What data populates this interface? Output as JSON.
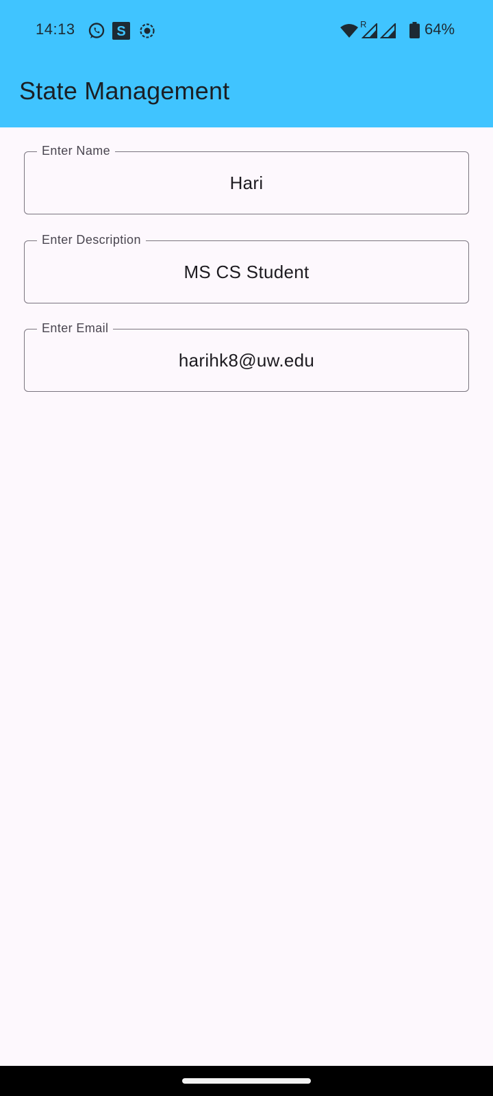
{
  "status_bar": {
    "time": "14:13",
    "battery_text": "64%",
    "roaming_indicator": "R",
    "icons": [
      "whatsapp-icon",
      "s-app-icon",
      "screen-record-icon",
      "wifi-icon",
      "signal-icon",
      "battery-icon"
    ]
  },
  "app_bar": {
    "title": "State Management",
    "color": "#40c4ff"
  },
  "form": {
    "name_field": {
      "label": "Enter Name",
      "value": "Hari"
    },
    "description_field": {
      "label": "Enter Description",
      "value": "MS CS Student"
    },
    "email_field": {
      "label": "Enter Email",
      "value": "harihk8@uw.edu"
    }
  }
}
